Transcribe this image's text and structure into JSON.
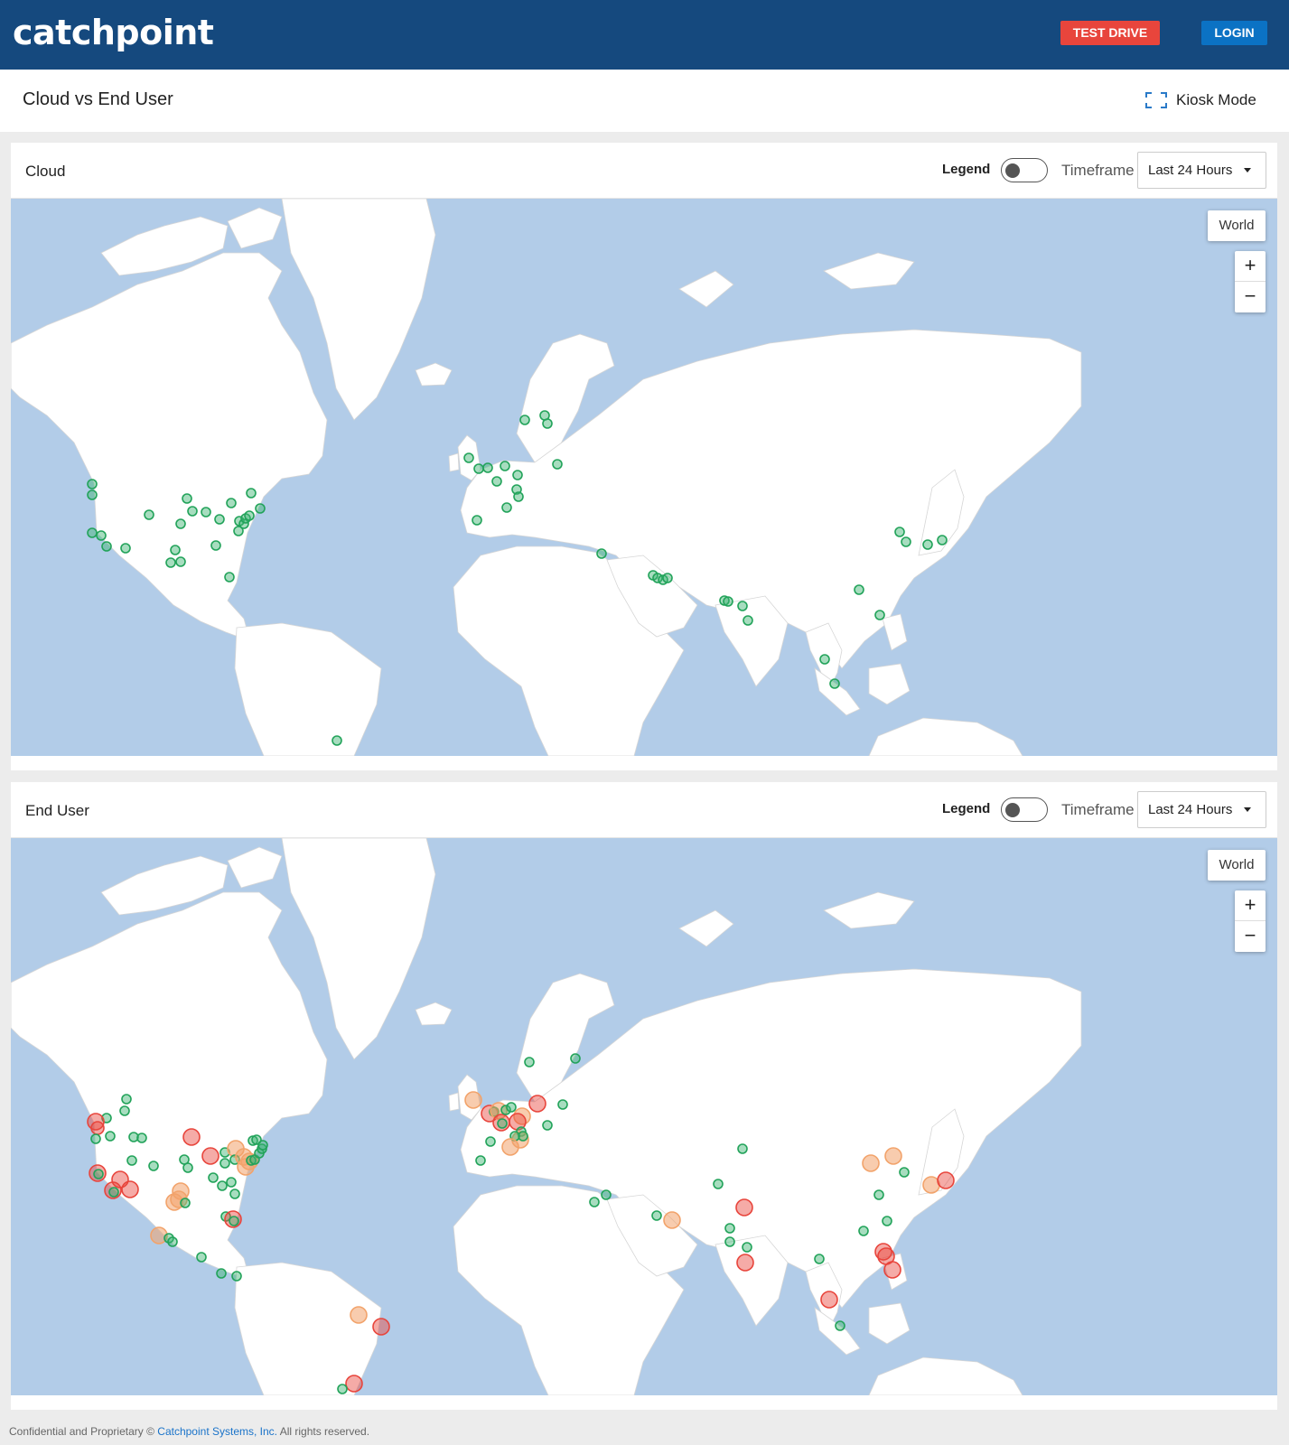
{
  "header": {
    "logo_text": "catchpoint",
    "test_drive_label": "TEST DRIVE",
    "login_label": "LOGIN"
  },
  "titlebar": {
    "title": "Cloud vs End User",
    "kiosk_label": "Kiosk Mode"
  },
  "panels": [
    {
      "title": "Cloud",
      "legend_label": "Legend",
      "legend_on": false,
      "timeframe_label": "Timeframe",
      "timeframe_value": "Last 24 Hours",
      "world_label": "World",
      "zoom_in": "+",
      "zoom_out": "−"
    },
    {
      "title": "End User",
      "legend_label": "Legend",
      "legend_on": false,
      "timeframe_label": "Timeframe",
      "timeframe_value": "Last 24 Hours",
      "world_label": "World",
      "zoom_in": "+",
      "zoom_out": "−"
    }
  ],
  "colors": {
    "ok": "#3cb371",
    "warn": "#f2a36b",
    "critical": "#e8453c",
    "ocean": "#b2cce8",
    "land": "#ffffff",
    "header": "#15497e"
  },
  "footer": {
    "prefix": "Confidential and Proprietary ©",
    "link": "Catchpoint Systems, Inc.",
    "suffix": "All rights reserved."
  }
}
